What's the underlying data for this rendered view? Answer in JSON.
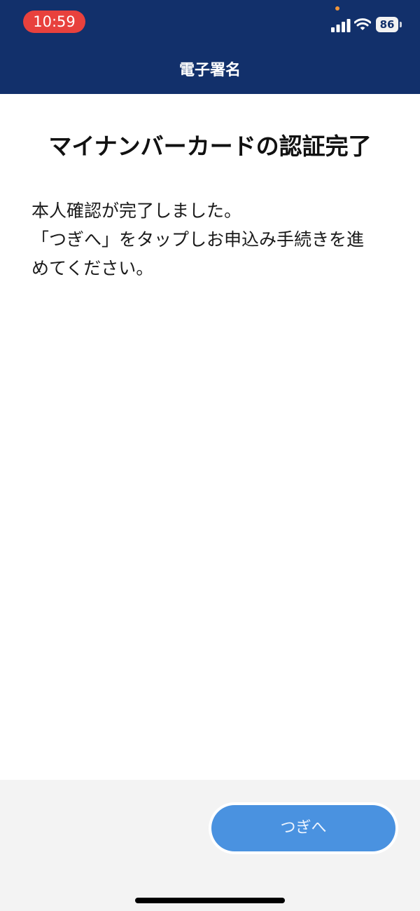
{
  "status_bar": {
    "time": "10:59",
    "battery_level": "86",
    "signal_icon": "cellular-signal-icon",
    "wifi_icon": "wifi-icon",
    "time_pill_color": "#e8413d"
  },
  "header": {
    "title": "電子署名",
    "background_color": "#12306b"
  },
  "main": {
    "heading": "マイナンバーカードの認証完了",
    "message_lines": [
      "本人確認が完了しました。",
      "「つぎへ」をタップしお申込み手続きを進",
      "めてください。"
    ]
  },
  "footer": {
    "next_button_label": "つぎへ",
    "button_color": "#4a92e0"
  }
}
